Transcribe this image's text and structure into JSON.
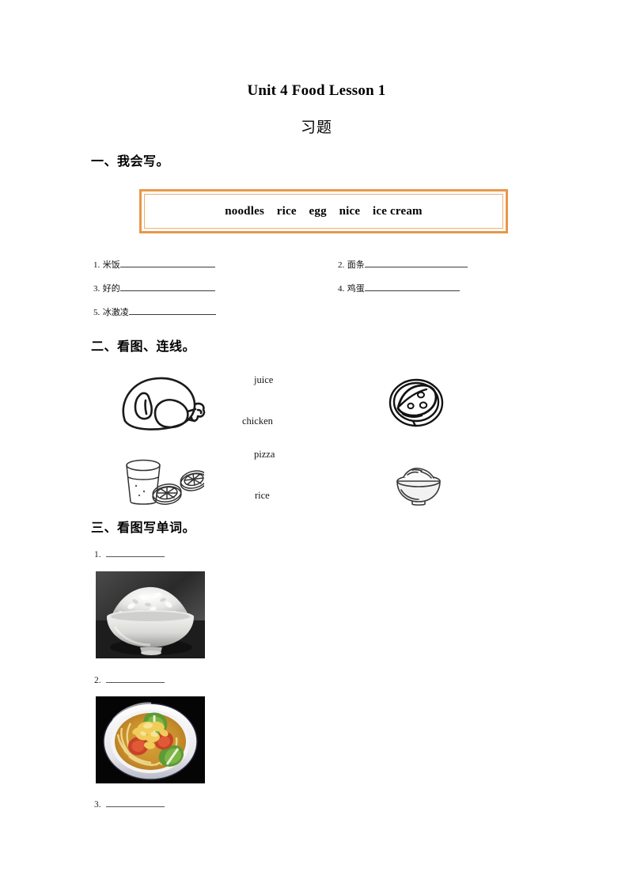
{
  "document": {
    "title": "Unit 4 Food Lesson 1",
    "subtitle": "习题"
  },
  "sections": [
    {
      "id": "section-1",
      "heading": "一、我会写。",
      "word_bank": {
        "words": [
          "noodles",
          "rice",
          "egg",
          "nice",
          "ice cream"
        ],
        "display": "noodles    rice    egg    nice    ice cream",
        "border_color": "#E8974B",
        "inner_border_color": "#F0AE74"
      },
      "items": [
        {
          "number": "1.",
          "prompt": "米饭",
          "answer": ""
        },
        {
          "number": "2.",
          "prompt": "面条",
          "answer": ""
        },
        {
          "number": "3.",
          "prompt": "好的",
          "answer": ""
        },
        {
          "number": "4.",
          "prompt": "鸡蛋",
          "answer": ""
        },
        {
          "number": "5.",
          "prompt": "冰激凌",
          "answer": ""
        }
      ]
    },
    {
      "id": "section-2",
      "heading": "二、看图、连线。",
      "words": [
        "juice",
        "chicken",
        "pizza",
        "rice"
      ],
      "left_images": [
        "chicken-drumstick-drawing",
        "juice-glass-with-orange-slices-drawing"
      ],
      "right_images": [
        "pizza-slice-drawing",
        "rice-bowl-drawing"
      ]
    },
    {
      "id": "section-3",
      "heading": "三、看图写单词。",
      "items": [
        {
          "number": "1.",
          "answer": "",
          "image": "bowl-of-white-rice-photo"
        },
        {
          "number": "2.",
          "answer": "",
          "image": "tomato-egg-noodle-soup-photo"
        },
        {
          "number": "3.",
          "answer": "",
          "image": ""
        }
      ]
    }
  ]
}
